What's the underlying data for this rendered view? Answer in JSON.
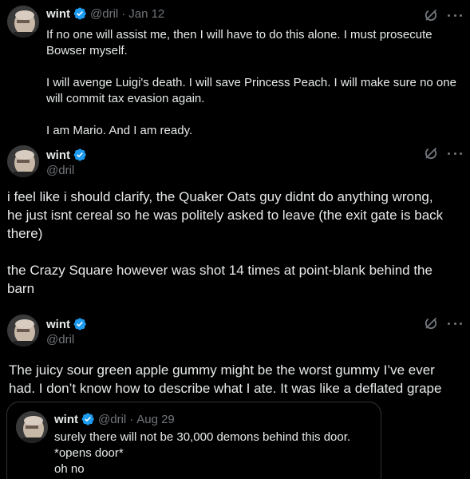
{
  "tweets": [
    {
      "name": "wint",
      "handle": "@dril",
      "sep": "·",
      "date": "Jan 12",
      "text": "If no one will assist me, then I will have to do this alone. I must prosecute\nBowser myself.\n\nI will avenge Luigi's death. I will save Princess Peach. I will make sure no one\nwill commit tax evasion again.\n\nI am Mario. And I am ready."
    },
    {
      "name": "wint",
      "handle": "@dril",
      "text": "i feel like i should clarify, the Quaker Oats guy didnt do anything wrong,\nhe just isnt cereal so he was politely asked to leave (the exit gate is back\nthere)\n\nthe Crazy Square however was shot 14 times at point-blank behind the\nbarn"
    },
    {
      "name": "wint",
      "handle": "@dril",
      "text": "The juicy sour green apple gummy might be the worst gummy I’ve ever\nhad. I don’t know how to describe what I ate. It was like a deflated grape"
    }
  ],
  "quote": {
    "name": "wint",
    "handle": "@dril",
    "sep": "·",
    "date": "Aug 29",
    "text": "surely there will not be 30,000 demons behind this door.\n*opens door*\noh no"
  },
  "colors": {
    "background": "#000000",
    "text": "#e7e9ea",
    "secondary": "#71767b",
    "verified": "#1d9bf0",
    "border": "#2f3336"
  },
  "icons": [
    "avatar",
    "verified-badge-icon",
    "grok-icon",
    "more-icon"
  ]
}
